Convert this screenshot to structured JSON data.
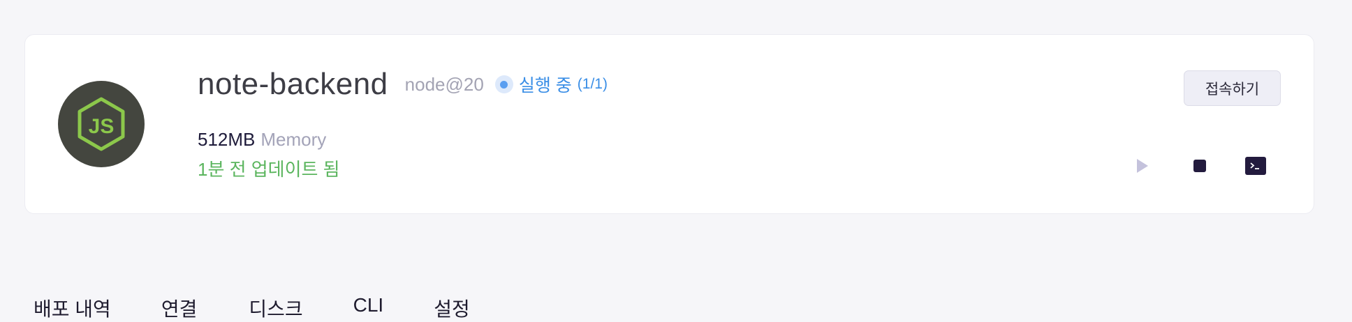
{
  "app": {
    "name": "note-backend",
    "runtime": "node@20",
    "status_text": "실행 중",
    "status_count": "(1/1)",
    "memory_value": "512MB",
    "memory_label": "Memory",
    "updated": "1분 전 업데이트 됨",
    "logo_icon": "nodejs-icon"
  },
  "actions": {
    "connect_label": "접속하기",
    "play_icon": "play-icon",
    "stop_icon": "stop-icon",
    "terminal_icon": "terminal-icon"
  },
  "tabs": [
    {
      "label": "배포 내역"
    },
    {
      "label": "연결"
    },
    {
      "label": "디스크"
    },
    {
      "label": "CLI"
    },
    {
      "label": "설정"
    }
  ],
  "colors": {
    "status_blue": "#3a8ee6",
    "updated_green": "#5bb55e",
    "node_green": "#8cc84b",
    "dark_navy": "#231b3e"
  }
}
